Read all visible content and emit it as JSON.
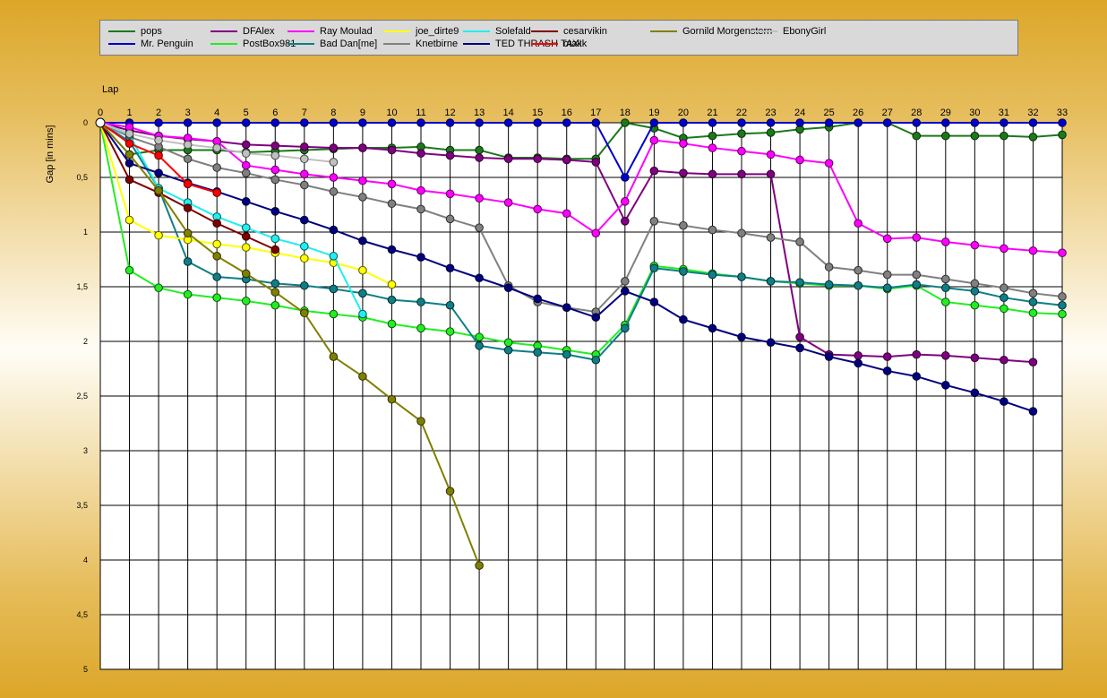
{
  "chart_data": {
    "type": "line",
    "xlabel": "Lap",
    "ylabel": "Gap [in mins]",
    "xlim": [
      0,
      33
    ],
    "ylim": [
      0,
      5
    ],
    "y_inverted": true,
    "grid": true,
    "legend_position": "top",
    "x_ticks": [
      "0",
      "1",
      "2",
      "3",
      "4",
      "5",
      "6",
      "7",
      "8",
      "9",
      "10",
      "11",
      "12",
      "13",
      "14",
      "15",
      "16",
      "17",
      "18",
      "19",
      "20",
      "21",
      "22",
      "23",
      "24",
      "25",
      "26",
      "27",
      "28",
      "29",
      "30",
      "31",
      "32",
      "33"
    ],
    "y_ticks": [
      "0",
      "0,5",
      "1",
      "1,5",
      "2",
      "2,5",
      "3",
      "3,5",
      "4",
      "4,5",
      "5"
    ],
    "series": [
      {
        "name": "pops",
        "color": "#1a7a1a",
        "x": [
          0,
          1,
          2,
          3,
          4,
          5,
          6,
          7,
          8,
          9,
          10,
          11,
          12,
          13,
          14,
          15,
          16,
          17,
          18,
          19,
          20,
          21,
          22,
          23,
          24,
          25,
          26,
          27,
          28,
          29,
          30,
          31,
          32,
          33
        ],
        "values": [
          0,
          0.29,
          0.25,
          0.25,
          0.25,
          0.27,
          0.26,
          0.25,
          0.24,
          0.23,
          0.23,
          0.22,
          0.25,
          0.25,
          0.32,
          0.32,
          0.33,
          0.33,
          0.0,
          0.05,
          0.14,
          0.12,
          0.1,
          0.09,
          0.06,
          0.04,
          0.0,
          0.0,
          0.12,
          0.12,
          0.12,
          0.12,
          0.13,
          0.11
        ]
      },
      {
        "name": "Mr. Penguin",
        "color": "#0000cc",
        "x": [
          0,
          1,
          2,
          3,
          4,
          5,
          6,
          7,
          8,
          9,
          10,
          11,
          12,
          13,
          14,
          15,
          16,
          17,
          18,
          19,
          20,
          21,
          22,
          23,
          24,
          25,
          26,
          27,
          28,
          29,
          30,
          31,
          32,
          33
        ],
        "values": [
          0,
          0,
          0,
          0,
          0,
          0,
          0,
          0,
          0,
          0,
          0,
          0,
          0,
          0,
          0,
          0,
          0,
          0,
          0.5,
          0,
          0,
          0,
          0,
          0,
          0,
          0,
          0,
          0,
          0,
          0,
          0,
          0,
          0,
          0
        ]
      },
      {
        "name": "DFAlex",
        "color": "#800080",
        "x": [
          0,
          1,
          2,
          3,
          4,
          5,
          6,
          7,
          8,
          9,
          10,
          11,
          12,
          13,
          14,
          15,
          16,
          17,
          18,
          19,
          20,
          21,
          22,
          23,
          24,
          25,
          26,
          27,
          28,
          29,
          30,
          31,
          32
        ],
        "values": [
          0,
          0.07,
          0.12,
          0.15,
          0.17,
          0.2,
          0.21,
          0.22,
          0.23,
          0.23,
          0.25,
          0.28,
          0.3,
          0.32,
          0.33,
          0.33,
          0.34,
          0.36,
          0.9,
          0.44,
          0.46,
          0.47,
          0.47,
          0.47,
          1.96,
          2.12,
          2.13,
          2.14,
          2.12,
          2.13,
          2.15,
          2.17,
          2.19
        ]
      },
      {
        "name": "PostBox981",
        "color": "#22ee22",
        "x": [
          0,
          1,
          2,
          3,
          4,
          5,
          6,
          7,
          8,
          9,
          10,
          11,
          12,
          13,
          14,
          15,
          16,
          17,
          18,
          19,
          20,
          21,
          22,
          23,
          24,
          25,
          26,
          27,
          28,
          29,
          30,
          31,
          32,
          33
        ],
        "values": [
          0,
          1.35,
          1.51,
          1.57,
          1.6,
          1.63,
          1.67,
          1.72,
          1.75,
          1.78,
          1.84,
          1.88,
          1.91,
          1.96,
          2.01,
          2.04,
          2.08,
          2.12,
          1.85,
          1.31,
          1.34,
          1.38,
          1.41,
          1.45,
          1.47,
          1.49,
          1.49,
          1.52,
          1.49,
          1.64,
          1.67,
          1.7,
          1.74,
          1.75
        ]
      },
      {
        "name": "Ray Moulad",
        "color": "#ff00ff",
        "x": [
          0,
          1,
          2,
          3,
          4,
          5,
          6,
          7,
          8,
          9,
          10,
          11,
          12,
          13,
          14,
          15,
          16,
          17,
          18,
          19,
          20,
          21,
          22,
          23,
          24,
          25,
          26,
          27,
          28,
          29,
          30,
          31,
          32,
          33
        ],
        "values": [
          0,
          0.04,
          0.12,
          0.14,
          0.17,
          0.39,
          0.43,
          0.47,
          0.5,
          0.53,
          0.56,
          0.62,
          0.65,
          0.69,
          0.73,
          0.79,
          0.83,
          1.01,
          0.72,
          0.16,
          0.19,
          0.23,
          0.26,
          0.29,
          0.34,
          0.37,
          0.92,
          1.06,
          1.05,
          1.09,
          1.12,
          1.15,
          1.17,
          1.19
        ]
      },
      {
        "name": "Bad Dan[me]",
        "color": "#0e7f86",
        "x": [
          0,
          1,
          2,
          3,
          4,
          5,
          6,
          7,
          8,
          9,
          10,
          11,
          12,
          13,
          14,
          15,
          16,
          17,
          18,
          19,
          20,
          21,
          22,
          23,
          24,
          25,
          26,
          27,
          28,
          29,
          30,
          31,
          32,
          33
        ],
        "values": [
          0,
          0.17,
          0.6,
          1.27,
          1.41,
          1.43,
          1.47,
          1.49,
          1.52,
          1.56,
          1.62,
          1.64,
          1.67,
          2.04,
          2.08,
          2.1,
          2.12,
          2.17,
          1.88,
          1.33,
          1.36,
          1.39,
          1.41,
          1.45,
          1.46,
          1.48,
          1.49,
          1.51,
          1.48,
          1.51,
          1.54,
          1.6,
          1.64,
          1.67
        ]
      },
      {
        "name": "joe_dirte9",
        "color": "#ffff00",
        "x": [
          0,
          1,
          2,
          3,
          4,
          5,
          6,
          7,
          8,
          9,
          10
        ],
        "values": [
          0,
          0.89,
          1.03,
          1.07,
          1.11,
          1.14,
          1.19,
          1.24,
          1.28,
          1.35,
          1.48
        ]
      },
      {
        "name": "Knetbirne",
        "color": "#808080",
        "x": [
          0,
          1,
          2,
          3,
          4,
          5,
          6,
          7,
          8,
          9,
          10,
          11,
          12,
          13,
          14,
          15,
          16,
          17,
          18,
          19,
          20,
          21,
          22,
          23,
          24,
          25,
          26,
          27,
          28,
          29,
          30,
          31,
          32,
          33
        ],
        "values": [
          0,
          0.13,
          0.22,
          0.33,
          0.41,
          0.46,
          0.52,
          0.57,
          0.63,
          0.68,
          0.74,
          0.79,
          0.88,
          0.96,
          1.49,
          1.64,
          1.69,
          1.73,
          1.45,
          0.9,
          0.94,
          0.98,
          1.01,
          1.05,
          1.09,
          1.32,
          1.35,
          1.39,
          1.39,
          1.43,
          1.47,
          1.51,
          1.56,
          1.59
        ]
      },
      {
        "name": "Solefald",
        "color": "#22eeee",
        "x": [
          0,
          1,
          2,
          3,
          4,
          5,
          6,
          7,
          8,
          9
        ],
        "values": [
          0,
          0.11,
          0.6,
          0.73,
          0.86,
          0.96,
          1.06,
          1.13,
          1.22,
          1.75
        ]
      },
      {
        "name": "TED THRASH TAXI",
        "color": "#000080",
        "x": [
          0,
          1,
          2,
          3,
          4,
          5,
          6,
          7,
          8,
          9,
          10,
          11,
          12,
          13,
          14,
          15,
          16,
          17,
          18,
          19,
          20,
          21,
          22,
          23,
          24,
          25,
          26,
          27,
          28,
          29,
          30,
          31,
          32
        ],
        "values": [
          0,
          0.37,
          0.46,
          0.55,
          0.63,
          0.72,
          0.81,
          0.89,
          0.98,
          1.08,
          1.16,
          1.23,
          1.33,
          1.42,
          1.51,
          1.61,
          1.69,
          1.78,
          1.54,
          1.64,
          1.8,
          1.88,
          1.96,
          2.01,
          2.06,
          2.14,
          2.2,
          2.27,
          2.32,
          2.4,
          2.47,
          2.55,
          2.64
        ]
      },
      {
        "name": "cesarvikin",
        "color": "#800000",
        "x": [
          0,
          1,
          2,
          3,
          4,
          5,
          6
        ],
        "values": [
          0,
          0.52,
          0.64,
          0.78,
          0.92,
          1.04,
          1.16
        ]
      },
      {
        "name": "otakk",
        "color": "#ff0000",
        "x": [
          0,
          1,
          2,
          3,
          4
        ],
        "values": [
          0,
          0.19,
          0.3,
          0.56,
          0.64
        ]
      },
      {
        "name": "Gornild Morgenstern",
        "color": "#808000",
        "x": [
          0,
          1,
          2,
          3,
          4,
          5,
          6,
          7,
          8,
          9,
          10,
          11,
          12,
          13
        ],
        "values": [
          0,
          0.29,
          0.62,
          1.01,
          1.22,
          1.38,
          1.55,
          1.74,
          2.14,
          2.32,
          2.53,
          2.73,
          3.37,
          4.05
        ]
      },
      {
        "name": "EbonyGirl",
        "color": "#c0c0c0",
        "x": [
          0,
          1,
          2,
          3,
          4,
          5,
          6,
          7,
          8
        ],
        "values": [
          0,
          0.1,
          0.16,
          0.2,
          0.23,
          0.28,
          0.3,
          0.33,
          0.36
        ]
      }
    ]
  }
}
